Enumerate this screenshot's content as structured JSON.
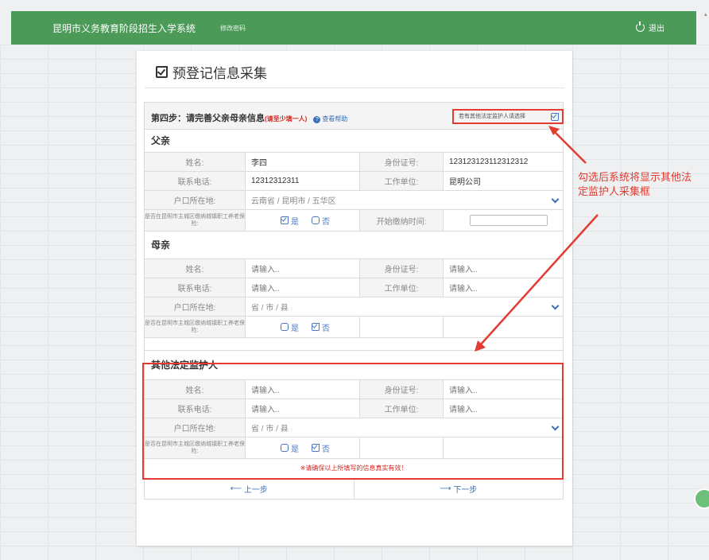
{
  "topbar": {
    "title": "昆明市义务教育阶段招生入学系统",
    "change_password": "修改密码",
    "logout": "退出"
  },
  "card": {
    "title": "预登记信息采集"
  },
  "step": {
    "label": "第四步：请完善父亲母亲信息",
    "hint": "(请至少填一人)",
    "help": "查看帮助",
    "other_guardian": "若有其他法定监护人请选择"
  },
  "labels": {
    "name": "姓名:",
    "id": "身份证号:",
    "phone": "联系电话:",
    "work": "工作单位:",
    "hukou": "户口所在地:",
    "insurance": "是否在昆明市主城区缴纳城镇职工养老保险:",
    "start_time": "开始缴纳时间:",
    "yes": "是",
    "no": "否"
  },
  "father": {
    "heading": "父亲",
    "name": "李四",
    "id": "123123123112312312",
    "phone": "12312312311",
    "work": "昆明公司",
    "hukou": "云南省 / 昆明市 / 五华区"
  },
  "mother": {
    "heading": "母亲",
    "name": "请输入..",
    "id": "请输入..",
    "phone": "请输入..",
    "work": "请输入..",
    "hukou": "省 / 市 / 县"
  },
  "guardian": {
    "heading": "其他法定监护人",
    "name": "请输入..",
    "id": "请输入..",
    "phone": "请输入..",
    "work": "请输入..",
    "hukou": "省 / 市 / 县"
  },
  "notice": "※请确保以上所填写的信息真实有效！",
  "nav": {
    "prev": "上一步",
    "next": "下一步"
  },
  "annotation": "勾选后系统将显示其他法定监护人采集框",
  "colors": {
    "topbar": "#4b9a57",
    "highlight": "#e23b32",
    "link": "#3a6fb8"
  }
}
